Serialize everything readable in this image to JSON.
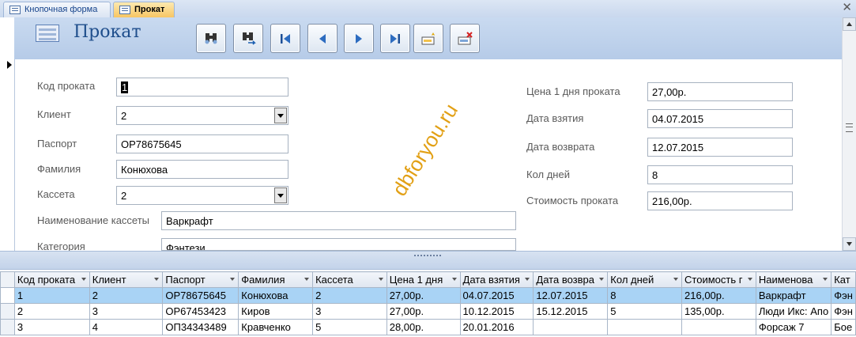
{
  "tabs": [
    {
      "label": "Кнопочная форма",
      "active": false
    },
    {
      "label": "Прокат",
      "active": true
    }
  ],
  "form": {
    "title": "Прокат",
    "nav_buttons": [
      "find-icon",
      "find-next-icon",
      "first-record-icon",
      "previous-record-icon",
      "next-record-icon",
      "last-record-icon",
      "new-record-icon",
      "delete-record-icon"
    ],
    "left_fields": {
      "code": {
        "label": "Код проката",
        "value": "1"
      },
      "client": {
        "label": "Клиент",
        "value": "2"
      },
      "passport": {
        "label": "Паспорт",
        "value": "ОР78675645"
      },
      "surname": {
        "label": "Фамилия",
        "value": "Конюхова"
      },
      "cassette": {
        "label": "Кассета",
        "value": "2"
      },
      "cassette_name": {
        "label": "Наименование кассеты",
        "value": "Варкрафт"
      },
      "category": {
        "label": "Категория",
        "value": "Фэнтези"
      }
    },
    "right_fields": {
      "price": {
        "label": "Цена 1 дня проката",
        "value": "27,00р."
      },
      "date_taken": {
        "label": "Дата взятия",
        "value": "04.07.2015"
      },
      "date_returned": {
        "label": "Дата возврата",
        "value": "12.07.2015"
      },
      "days": {
        "label": "Кол дней",
        "value": "8"
      },
      "cost": {
        "label": "Стоимость проката",
        "value": "216,00р."
      }
    },
    "watermark": "dbforyou.ru"
  },
  "datasheet": {
    "columns": [
      "Код проката",
      "Клиент",
      "Паспорт",
      "Фамилия",
      "Кассета",
      "Цена 1 дня",
      "Дата взятия",
      "Дата возвра",
      "Кол дней",
      "Стоимость г",
      "Наименова",
      "Кат"
    ],
    "rows": [
      [
        "1",
        "2",
        "ОР78675645",
        "Конюхова",
        "2",
        "27,00р.",
        "04.07.2015",
        "12.07.2015",
        "8",
        "216,00р.",
        "Варкрафт",
        "Фэн"
      ],
      [
        "2",
        "3",
        "ОР67453423",
        "Киров",
        "3",
        "27,00р.",
        "10.12.2015",
        "15.12.2015",
        "5",
        "135,00р.",
        "Люди Икс: Апо",
        "Фэн"
      ],
      [
        "3",
        "4",
        "ОП34343489",
        "Кравченко",
        "5",
        "28,00р.",
        "20.01.2016",
        "",
        "",
        "",
        "Форсаж 7",
        "Бое"
      ]
    ]
  }
}
